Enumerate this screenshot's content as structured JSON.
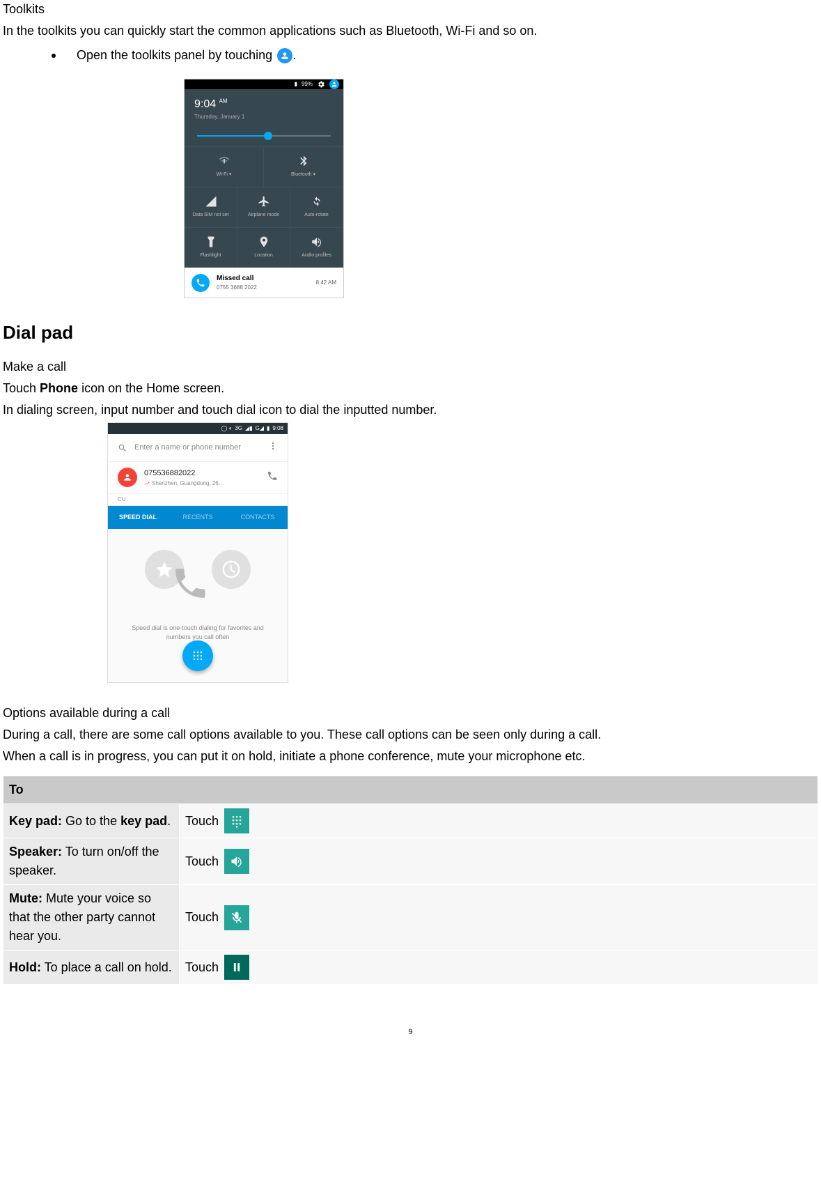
{
  "toolkits": {
    "title": "Toolkits",
    "intro": "In the toolkits you can quickly start the common applications such as Bluetooth, Wi-Fi and so on.",
    "bullet": "Open the toolkits panel by touching",
    "bullet_suffix": "."
  },
  "toolkit_shot": {
    "battery": "99%",
    "time": "9:04",
    "time_ampm": "AM",
    "date": "Thursday, January 1",
    "tiles": {
      "wifi": "Wi-Fi",
      "bluetooth": "Bluetooth",
      "data_sim": "Data SIM not set",
      "airplane": "Airplane mode",
      "auto_rotate": "Auto-rotate",
      "flashlight": "Flashlight",
      "location": "Location",
      "audio": "Audio profiles"
    },
    "notif": {
      "title": "Missed call",
      "number": "0755 3688 2022",
      "time": "8:42 AM"
    }
  },
  "dialpad": {
    "heading": "Dial pad",
    "make": "Make a call",
    "touch_line_pre": "Touch ",
    "touch_line_bold": "Phone",
    "touch_line_post": " icon on the Home screen.",
    "dial_line": "In dialing screen, input number and touch dial icon to dial the inputted number."
  },
  "dial_shot": {
    "status_text": "3G",
    "status_time": "9:08",
    "search_placeholder": "Enter a name or phone number",
    "recent_number": "075536882022",
    "recent_loc": "Shenzhen, Guangdong, 26…",
    "cu": "CU",
    "tabs": {
      "speed": "SPEED DIAL",
      "recents": "RECENTS",
      "contacts": "CONTACTS"
    },
    "speed_text": "Speed dial is one-touch dialing for favorites and numbers you call often"
  },
  "options": {
    "title": "Options available during a call",
    "p1": "During a call, there are some call options available to you. These call options can be seen only during a call.",
    "p2": "When a call is in progress, you can put it on hold, initiate a phone conference, mute your microphone etc."
  },
  "table": {
    "header": "To",
    "touch": "Touch",
    "rows": {
      "keypad_label": "Key pad:",
      "keypad_desc": " Go to the ",
      "keypad_bold": "key pad",
      "keypad_post": ".",
      "speaker_label": "Speaker:",
      "speaker_desc": " To turn on/off the speaker.",
      "mute_label": "Mute:",
      "mute_desc": " Mute your voice so that the other party cannot hear you.",
      "hold_label": "Hold:",
      "hold_desc": " To place a call on hold."
    }
  },
  "page_number": "9"
}
